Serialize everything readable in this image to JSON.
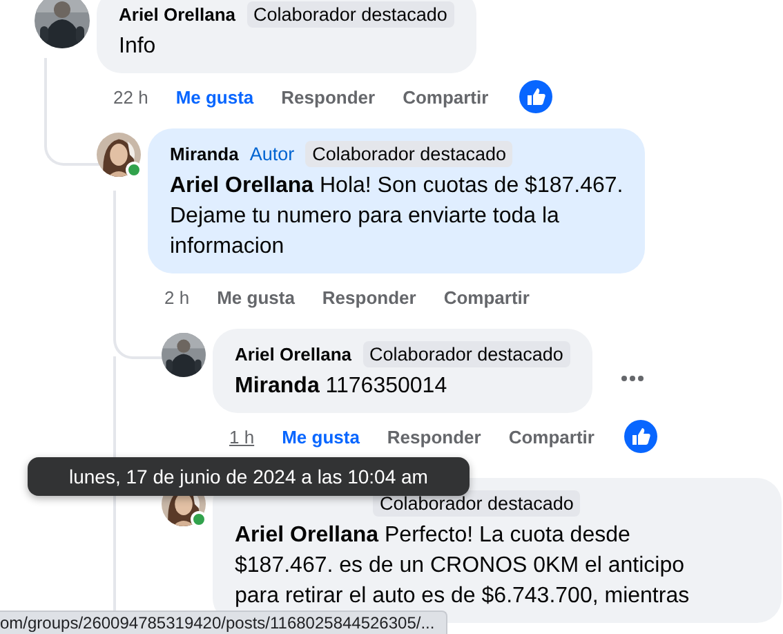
{
  "comments": [
    {
      "author": "Ariel Orellana",
      "badges": [
        {
          "kind": "badge",
          "text": "Colaborador destacado"
        }
      ],
      "text_lines": [
        "Info"
      ],
      "time": "22 h",
      "hovered": false,
      "like_label": "Me gusta",
      "reply_label": "Responder",
      "share_label": "Compartir",
      "liked": true,
      "online": false,
      "highlighted": false,
      "more_menu": false,
      "children": [
        {
          "author": "Miranda",
          "badges": [
            {
              "kind": "role",
              "text": "Autor"
            },
            {
              "kind": "badge",
              "text": "Colaborador destacado"
            }
          ],
          "mention": "Ariel Orellana",
          "text_lines": [
            "Hola! Son cuotas de $187.467.",
            "Dejame tu numero para enviarte toda la",
            "informacion"
          ],
          "time": "2 h",
          "hovered": false,
          "like_label": "Me gusta",
          "reply_label": "Responder",
          "share_label": "Compartir",
          "liked": false,
          "online": true,
          "highlighted": true,
          "more_menu": false,
          "children": [
            {
              "author": "Ariel Orellana",
              "badges": [
                {
                  "kind": "badge",
                  "text": "Colaborador destacado"
                }
              ],
              "mention": "Miranda",
              "text_lines": [
                "1176350014"
              ],
              "time": "1 h",
              "hovered": true,
              "like_label": "Me gusta",
              "reply_label": "Responder",
              "share_label": "Compartir",
              "liked": true,
              "online": false,
              "highlighted": false,
              "more_menu": true
            },
            {
              "badges": [
                {
                  "kind": "badge",
                  "text": "Colaborador destacado"
                }
              ],
              "mention": "Ariel Orellana",
              "text_lines": [
                "Perfecto! La cuota desde",
                "$187.467. es de un CRONOS 0KM el anticipo",
                "para retirar el auto es de $6.743.700, mientras"
              ],
              "online": true,
              "highlighted": false,
              "more_menu": false
            }
          ]
        }
      ]
    }
  ],
  "tooltip": "lunes, 17 de junio de 2024 a las 10:04 am",
  "status_bar": "om/groups/260094785319420/posts/1168025844526305/..."
}
